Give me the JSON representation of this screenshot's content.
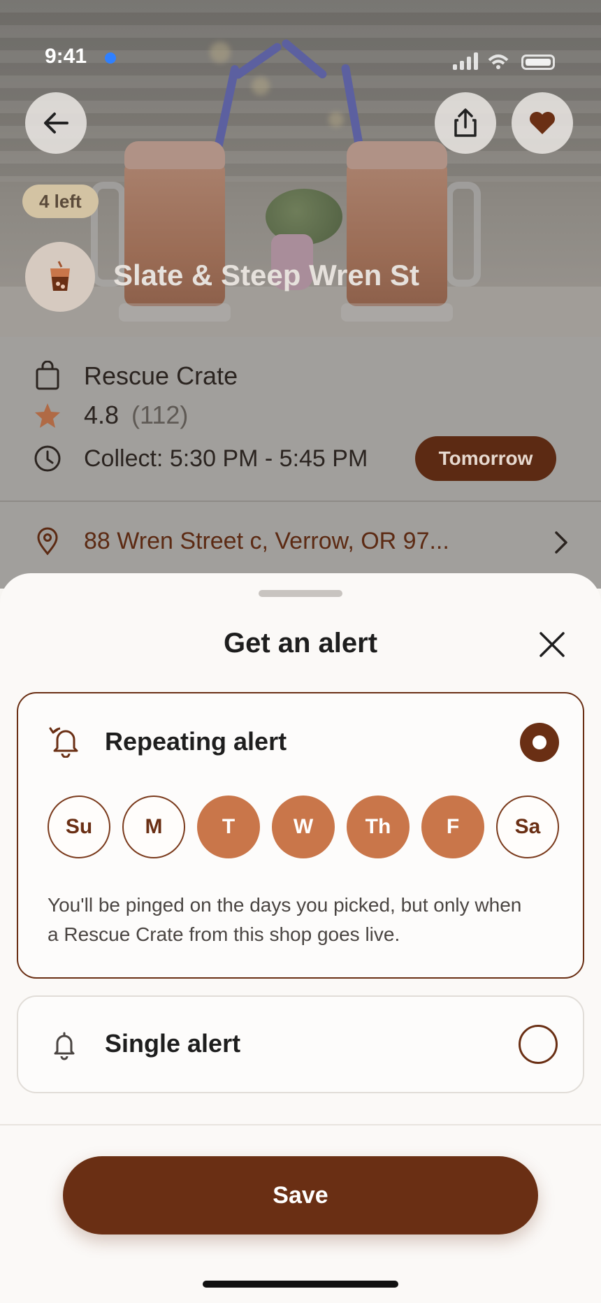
{
  "status_bar": {
    "time": "9:41"
  },
  "hero": {
    "stock_badge": "4 left",
    "shop_name": "Slate & Steep Wren St",
    "icons": {
      "back": "back-arrow-icon",
      "share": "share-icon",
      "favorite": "heart-icon",
      "logo": "cup-icon"
    }
  },
  "info": {
    "product": "Rescue Crate",
    "rating": "4.8",
    "reviews": "(112)",
    "collect": "Collect: 5:30 PM - 5:45 PM",
    "when_badge": "Tomorrow",
    "address": "88 Wren Street c, Verrow, OR 97..."
  },
  "sheet": {
    "title": "Get an alert",
    "repeating": {
      "label": "Repeating alert",
      "selected": true,
      "days": [
        {
          "label": "Su",
          "selected": false
        },
        {
          "label": "M",
          "selected": false
        },
        {
          "label": "T",
          "selected": true
        },
        {
          "label": "W",
          "selected": true
        },
        {
          "label": "Th",
          "selected": true
        },
        {
          "label": "F",
          "selected": true
        },
        {
          "label": "Sa",
          "selected": false
        }
      ],
      "description": "You'll be pinged on the days you picked, but only when a Rescue Crate from this shop goes live."
    },
    "single": {
      "label": "Single alert",
      "selected": false
    },
    "save_label": "Save"
  },
  "colors": {
    "brand": "#6a2f14",
    "accent": "#c9764a",
    "badge": "#5c2a13"
  }
}
